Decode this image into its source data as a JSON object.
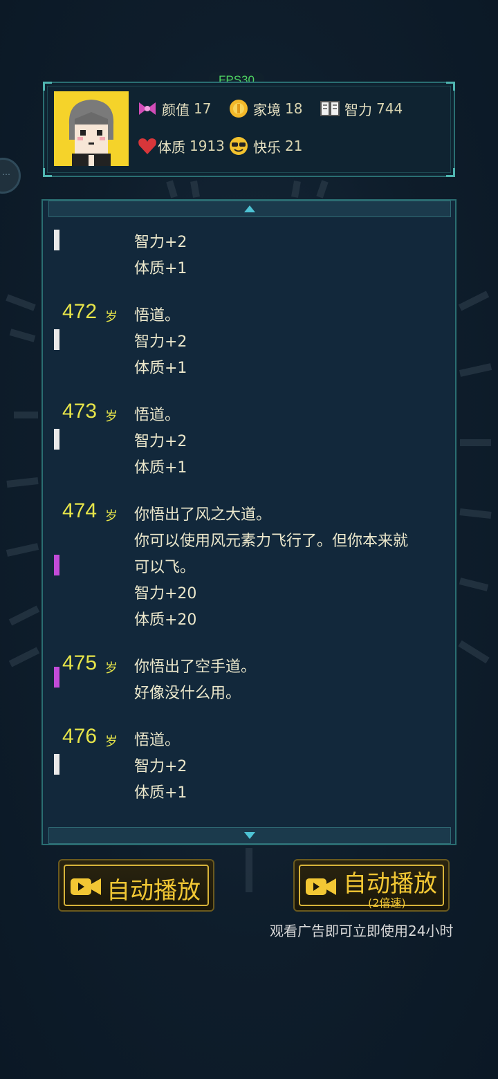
{
  "fps": "FPS30",
  "stats": {
    "appearance": {
      "label": "颜值",
      "value": "17",
      "icon": "bow-icon"
    },
    "family": {
      "label": "家境",
      "value": "18",
      "icon": "coin-icon"
    },
    "intelligence": {
      "label": "智力",
      "value": "744",
      "icon": "book-icon"
    },
    "constitution": {
      "label": "体质",
      "value": "1913",
      "icon": "heart-icon"
    },
    "happiness": {
      "label": "快乐",
      "value": "21",
      "icon": "sunglasses-face-icon"
    }
  },
  "log": {
    "age_unit": "岁",
    "partial": {
      "lines": [
        "智力+2",
        "体质+1"
      ]
    },
    "entries": [
      {
        "age": "472",
        "lines": [
          "悟道。",
          "智力+2",
          "体质+1"
        ],
        "marker": "white"
      },
      {
        "age": "473",
        "lines": [
          "悟道。",
          "智力+2",
          "体质+1"
        ],
        "marker": "white"
      },
      {
        "age": "474",
        "lines": [
          "你悟出了风之大道。",
          "你可以使用风元素力飞行了。但你本来就",
          "可以飞。",
          "智力+20",
          "体质+20"
        ],
        "marker": "purple"
      },
      {
        "age": "475",
        "lines": [
          "你悟出了空手道。",
          "好像没什么用。"
        ],
        "marker": "purple"
      },
      {
        "age": "476",
        "lines": [
          "悟道。",
          "智力+2",
          "体质+1"
        ],
        "marker": "white"
      }
    ]
  },
  "buttons": {
    "auto_play": "自动播放",
    "auto_play_2x": "自动播放",
    "auto_play_2x_sub": "(2倍速)"
  },
  "ad_note": "观看广告即可立即使用24小时",
  "colors": {
    "age": "#e7e54a",
    "button_text": "#f2c734",
    "panel_border": "#2a6e72",
    "marker_purple": "#c24bd8"
  }
}
